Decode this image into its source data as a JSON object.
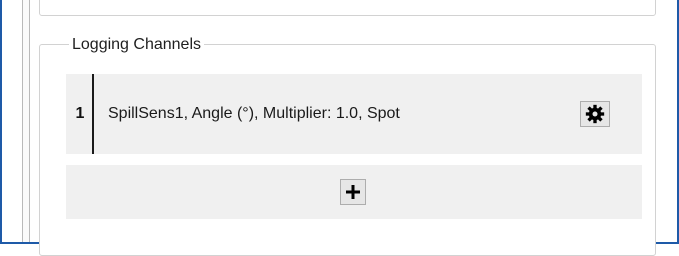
{
  "logging_channels": {
    "title": "Logging Channels",
    "channels": [
      {
        "index": "1",
        "description": "SpillSens1, Angle (°), Multiplier: 1.0, Spot",
        "settings_icon": "gear-icon"
      }
    ],
    "add_icon": "plus-icon"
  },
  "colors": {
    "window_border": "#1e5aa8",
    "row_background": "#f0f0f0",
    "button_face": "#e6e6e6"
  }
}
